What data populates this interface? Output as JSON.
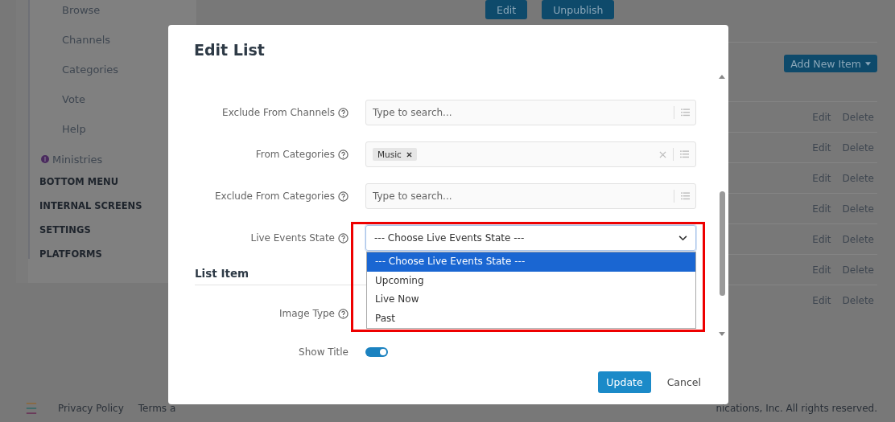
{
  "sidebar": {
    "items": [
      {
        "label": "Browse",
        "kind": "sub"
      },
      {
        "label": "Channels",
        "kind": "sub"
      },
      {
        "label": "Categories",
        "kind": "sub"
      },
      {
        "label": "Vote",
        "kind": "sub"
      },
      {
        "label": "Help",
        "kind": "sub"
      },
      {
        "label": "Ministries",
        "kind": "badge"
      },
      {
        "label": "BOTTOM MENU",
        "kind": "section"
      },
      {
        "label": "INTERNAL SCREENS",
        "kind": "section"
      },
      {
        "label": "SETTINGS",
        "kind": "section"
      },
      {
        "label": "PLATFORMS",
        "kind": "section"
      }
    ]
  },
  "page": {
    "top_buttons": [
      "Edit",
      "Unpublish"
    ],
    "add_button": "Add New Item",
    "rows": [
      {
        "actions": [
          "Edit",
          "Delete"
        ]
      },
      {
        "actions": [
          "Edit",
          "Delete"
        ]
      },
      {
        "actions": [
          "Edit",
          "Delete"
        ]
      },
      {
        "actions": [
          "Edit",
          "Delete"
        ]
      },
      {
        "actions": [
          "Edit",
          "Delete"
        ]
      },
      {
        "actions": [
          "Edit",
          "Delete"
        ]
      },
      {
        "actions": [
          "Edit",
          "Delete"
        ]
      }
    ]
  },
  "footer": {
    "links": [
      "Privacy Policy",
      "Terms a"
    ],
    "copyright": "nications, Inc. All rights reserved."
  },
  "modal": {
    "title": "Edit List",
    "fields": [
      {
        "label": "Exclude From Channels",
        "kind": "search",
        "placeholder": "Type to search..."
      },
      {
        "label": "From Categories",
        "kind": "tags",
        "tags": [
          "Music"
        ]
      },
      {
        "label": "Exclude From Categories",
        "kind": "search",
        "placeholder": "Type to search..."
      },
      {
        "label": "Live Events State",
        "kind": "select",
        "value": "--- Choose Live Events State ---",
        "expanded": true,
        "highlighted": true,
        "options": [
          {
            "label": "--- Choose Live Events State ---",
            "selected": true
          },
          {
            "label": "Upcoming",
            "selected": false
          },
          {
            "label": "Live Now",
            "selected": false
          },
          {
            "label": "Past",
            "selected": false
          }
        ]
      }
    ],
    "section": "List Item",
    "item_fields": [
      {
        "label": "Image Type",
        "kind": "blank"
      },
      {
        "label": "Show Title",
        "kind": "toggle",
        "on": true
      }
    ],
    "buttons": [
      {
        "label": "Update",
        "kind": "primary"
      },
      {
        "label": "Cancel",
        "kind": "link"
      }
    ]
  }
}
